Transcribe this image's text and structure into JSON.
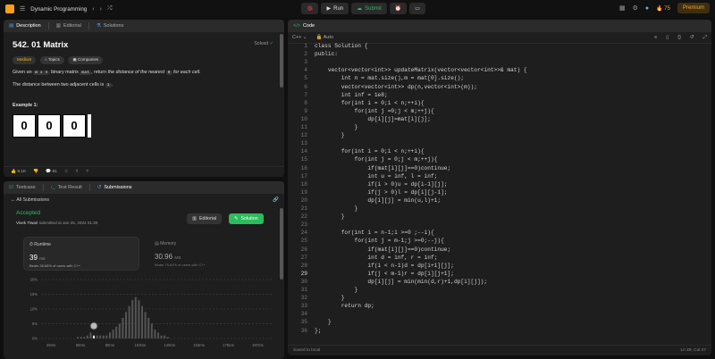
{
  "topbar": {
    "title": "Dynamic Programming",
    "run": "Run",
    "submit": "Submit",
    "streak": "75",
    "premium": "Premium"
  },
  "left_tabs": {
    "description": "Description",
    "editorial": "Editorial",
    "solutions": "Solutions"
  },
  "problem": {
    "title": "542. 01 Matrix",
    "status": "Solved",
    "difficulty": "Medium",
    "topics": "Topics",
    "companies": "Companies",
    "p1a": "Given an",
    "p1code": "m x n",
    "p1b": "binary matrix",
    "p1code2": "mat",
    "p1c": ", return",
    "p1d": "the distance of the nearest",
    "p1code3": "0",
    "p1e": "for each cell.",
    "p2a": "The distance between two adjacent cells is",
    "p2code": "1",
    "p2b": ".",
    "example": "Example 1:",
    "matrix": [
      "0",
      "0",
      "0"
    ]
  },
  "desc_footer": {
    "likes": "9.1K",
    "comments": "61"
  },
  "bottom_tabs": {
    "testcase": "Testcase",
    "result": "Test Result",
    "submissions": "Submissions"
  },
  "submission": {
    "back": "All Submissions",
    "status": "Accepted",
    "user": "Vivek Tiwari",
    "submitted": "submitted at Jan 25, 2024 01:30",
    "editorial_btn": "Editorial",
    "solution_btn": "Solution",
    "runtime_label": "Runtime",
    "runtime_val": "39",
    "runtime_unit": "ms",
    "runtime_beats": "Beats 38.65% of users with C++",
    "memory_label": "Memory",
    "memory_val": "30.96",
    "memory_unit": "MB",
    "memory_beats": "Beats 75.81% of users with C++"
  },
  "chart_data": {
    "type": "bar",
    "y_ticks": [
      "20%",
      "15%",
      "10%",
      "5%",
      "0%"
    ],
    "x_ticks": [
      "35ms",
      "58ms",
      "80ms",
      "103ms",
      "125ms",
      "153ms",
      "175ms",
      "197ms"
    ],
    "values": [
      0.5,
      0.5,
      0.5,
      1,
      2,
      1,
      1,
      1,
      1,
      1,
      2,
      3,
      4,
      5,
      7,
      9,
      11,
      13,
      14,
      13,
      11,
      9,
      7,
      5,
      3,
      2,
      1,
      1,
      0.5
    ]
  },
  "code_header": {
    "tab": "Code",
    "lang": "C++",
    "mode": "Auto"
  },
  "code_lines": [
    "class Solution {",
    "public:",
    "",
    "    vector<vector<int>> updateMatrix(vector<vector<int>>& mat) {",
    "        int n = mat.size(),m = mat[0].size();",
    "        vector<vector<int>> dp(n,vector<int>(m));",
    "        int inf = 1e8;",
    "        for(int i = 0;i < n;++i){",
    "            for(int j =0;j < m;++j){",
    "                dp[i][j]=mat[i][j];",
    "            }",
    "        }",
    "",
    "        for(int i = 0;i < n;++i){",
    "            for(int j = 0;j < m;++j){",
    "                if(mat[i][j]==0)continue;",
    "                int u = inf, l = inf;",
    "                if(i > 0)u = dp[i-1][j];",
    "                if(j > 0)l = dp[i][j-1];",
    "                dp[i][j] = min(u,l)+1;",
    "            }",
    "        }",
    "",
    "        for(int i = n-1;i >=0 ;--i){",
    "            for(int j = m-1;j >=0;--j){",
    "                if(mat[i][j]==0)continue;",
    "                int d = inf, r = inf;",
    "                if(i < n-1)d = dp[i+1][j];",
    "                if(j < m-1)r = dp[i][j+1];",
    "                dp[i][j] = min(min(d,r)+1,dp[i][j]);",
    "            }",
    "        }",
    "        return dp;",
    "",
    "    }",
    "};"
  ],
  "code_footer": {
    "saved": "Saved to local",
    "position": "Ln 29, Col 27"
  }
}
